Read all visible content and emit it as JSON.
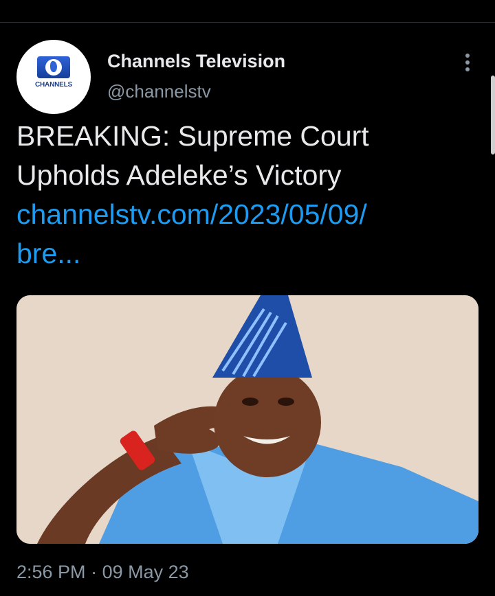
{
  "author": {
    "display_name": "Channels Television",
    "handle": "@channelstv",
    "logo_text": "CHANNELS"
  },
  "tweet": {
    "text": "BREAKING: Supreme Court Upholds Adeleke’s Victory",
    "link_line1": "channelstv.com/2023/05/09/",
    "link_line2": "bre..."
  },
  "meta": {
    "time": "2:56 PM",
    "separator": "·",
    "date": "09 May 23"
  },
  "icons": {
    "more": "more-vertical-icon"
  },
  "colors": {
    "background": "#000000",
    "text": "#e7e9ea",
    "secondary": "#8b98a5",
    "link": "#1d9bf0"
  }
}
